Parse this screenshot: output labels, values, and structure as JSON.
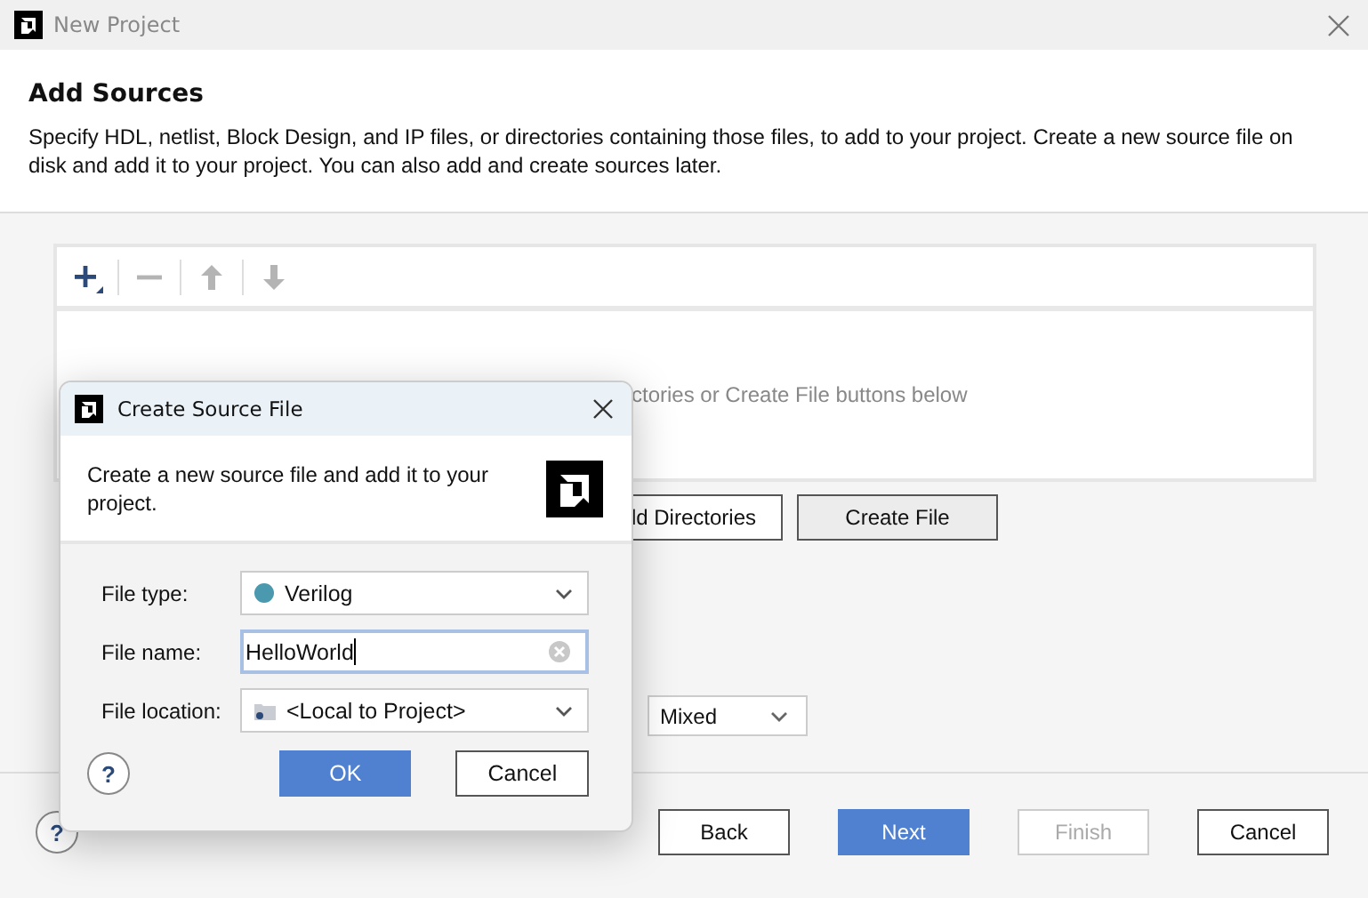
{
  "window": {
    "title": "New Project"
  },
  "header": {
    "title": "Add Sources",
    "description": "Specify HDL, netlist, Block Design, and IP files, or directories containing those files, to add to your project. Create a new source file on disk and add it to your project. You can also add and create sources later."
  },
  "toolbar": [
    {
      "kind": "add",
      "disabled": false
    },
    {
      "kind": "remove",
      "disabled": true
    },
    {
      "kind": "up",
      "disabled": true
    },
    {
      "kind": "down",
      "disabled": true
    }
  ],
  "sources": {
    "hint": "ctories or Create File buttons below"
  },
  "source_buttons": [
    {
      "label": "ld Directories",
      "pressed": false
    },
    {
      "label": "Create File",
      "pressed": true
    }
  ],
  "language_select": {
    "value": "Mixed"
  },
  "help_button": {
    "label": "?"
  },
  "footer_buttons": [
    {
      "label": "Back",
      "primary": false,
      "disabled": false
    },
    {
      "label": "Next",
      "primary": true,
      "disabled": false
    },
    {
      "label": "Finish",
      "primary": false,
      "disabled": true
    },
    {
      "label": "Cancel",
      "primary": false,
      "disabled": false
    }
  ],
  "dialog": {
    "title": "Create Source File",
    "description": "Create a new source file and add it to your project.",
    "fields": [
      {
        "label": "File type:",
        "kind": "select",
        "value": "Verilog",
        "color": "#4a99ae",
        "focused": false
      },
      {
        "label": "File name:",
        "kind": "text",
        "value": "HelloWorld",
        "focused": true
      },
      {
        "label": "File location:",
        "kind": "folder",
        "value": "<Local to Project>",
        "focused": false
      }
    ],
    "help_button": {
      "label": "?"
    },
    "buttons": [
      {
        "label": "OK",
        "primary": true
      },
      {
        "label": "Cancel",
        "primary": false
      }
    ]
  }
}
